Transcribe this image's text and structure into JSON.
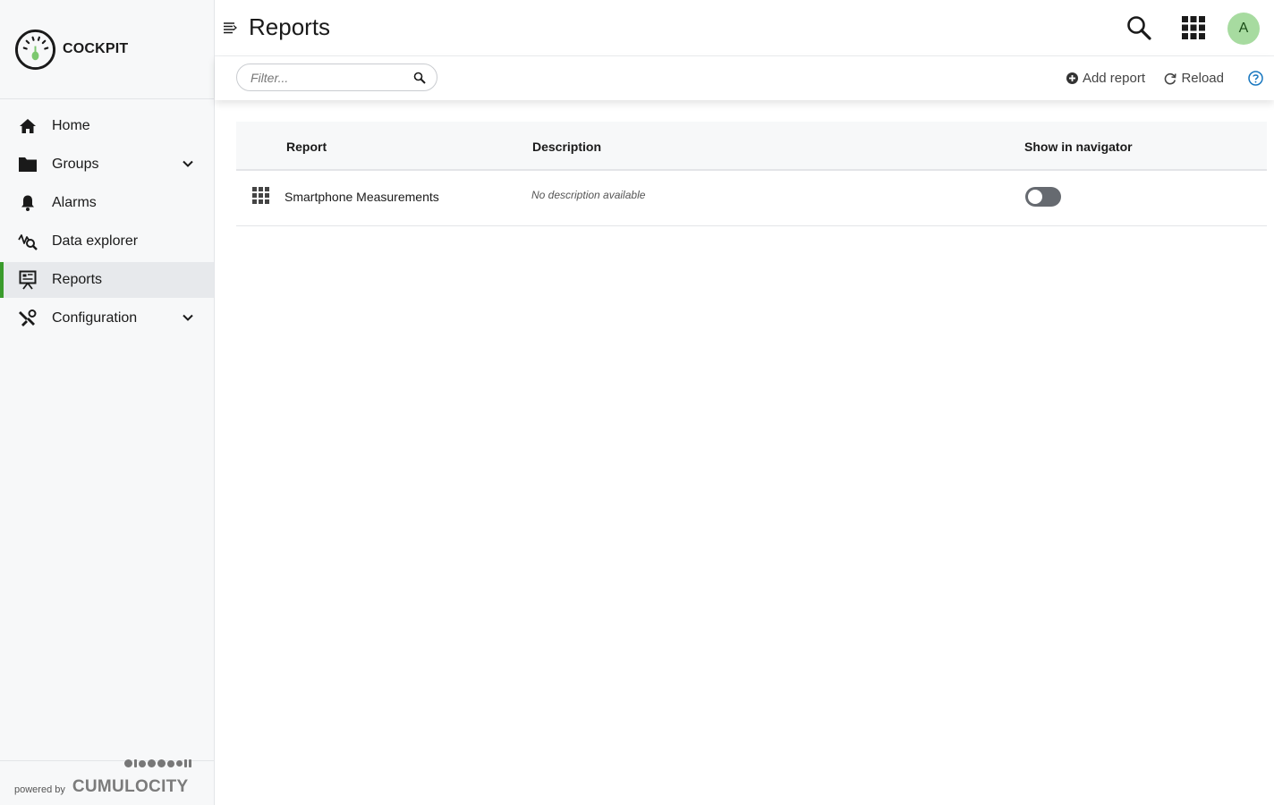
{
  "app": {
    "name": "COCKPIT"
  },
  "sidebar": {
    "items": [
      {
        "label": "Home",
        "icon": "home-icon",
        "active": false,
        "expandable": false
      },
      {
        "label": "Groups",
        "icon": "folder-icon",
        "active": false,
        "expandable": true
      },
      {
        "label": "Alarms",
        "icon": "bell-icon",
        "active": false,
        "expandable": false
      },
      {
        "label": "Data explorer",
        "icon": "data-explorer-icon",
        "active": false,
        "expandable": false
      },
      {
        "label": "Reports",
        "icon": "presentation-icon",
        "active": true,
        "expandable": false
      },
      {
        "label": "Configuration",
        "icon": "wrench-icon",
        "active": false,
        "expandable": true
      }
    ],
    "footer": {
      "powered_by": "powered by",
      "brand": "CUMULOCITY"
    }
  },
  "header": {
    "title": "Reports",
    "avatar_initial": "A"
  },
  "actionbar": {
    "filter_placeholder": "Filter...",
    "add_report": "Add report",
    "reload": "Reload"
  },
  "table": {
    "columns": [
      "Report",
      "Description",
      "Show in navigator"
    ],
    "rows": [
      {
        "name": "Smartphone Measurements",
        "description": "No description available",
        "show_in_navigator": false
      }
    ]
  },
  "colors": {
    "accent": "#3a9b2c",
    "avatar_bg": "#a7dba0",
    "help": "#1776bf"
  }
}
